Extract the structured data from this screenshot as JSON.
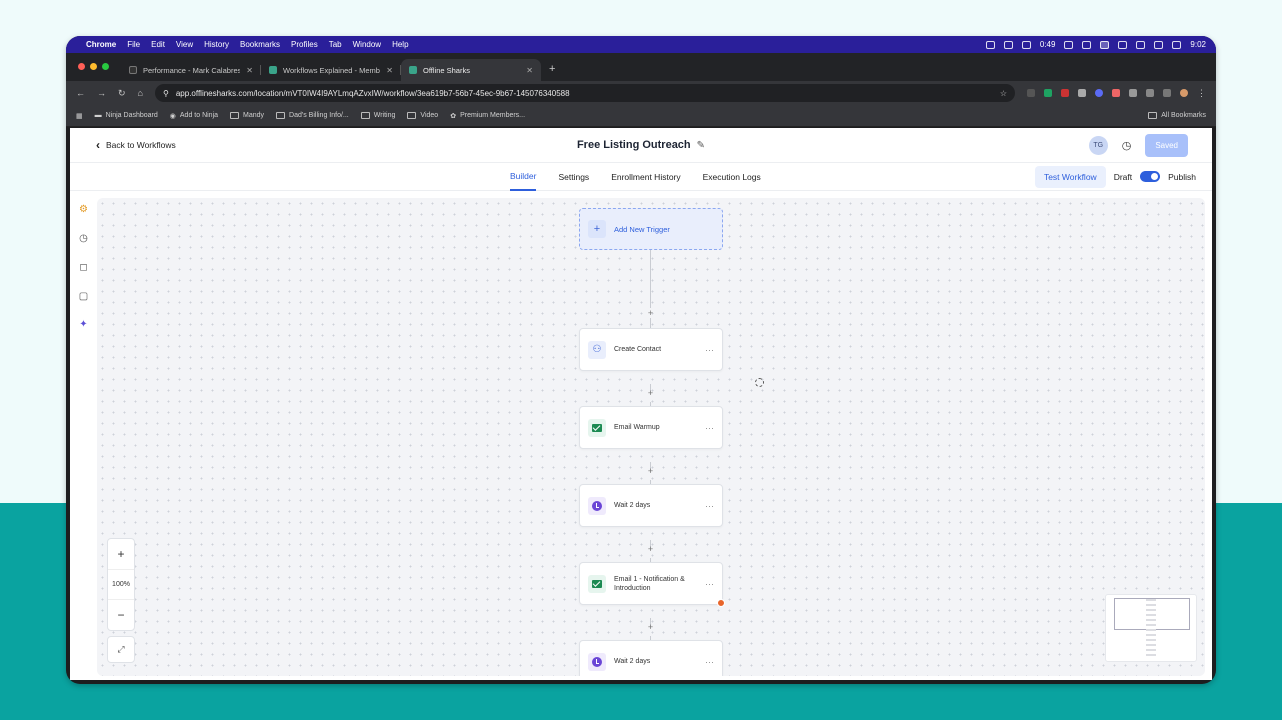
{
  "mac_menu": {
    "app": "Chrome",
    "items": [
      "File",
      "Edit",
      "View",
      "History",
      "Bookmarks",
      "Profiles",
      "Tab",
      "Window",
      "Help"
    ],
    "timer": "0:49",
    "clock": "9:02"
  },
  "browser": {
    "tabs": [
      {
        "title": "Performance - Mark Calabrese",
        "active": false
      },
      {
        "title": "Workflows Explained - Membership",
        "active": false
      },
      {
        "title": "Offline Sharks",
        "active": true
      }
    ],
    "url": "app.offlinesharks.com/location/mVT0IW4I9AYLmqAZvxIW/workflow/3ea619b7-56b7-45ec-9b67-145076340588",
    "bookmarks": [
      "Ninja Dashboard",
      "Add to Ninja",
      "Mandy",
      "Dad's Billing Info/...",
      "Writing",
      "Video",
      "Premium Members..."
    ],
    "all_bookmarks": "All Bookmarks"
  },
  "header": {
    "back_label": "Back to Workflows",
    "title": "Free Listing Outreach",
    "avatar_initials": "TG",
    "saved_label": "Saved"
  },
  "subnav": {
    "tabs": [
      {
        "label": "Builder",
        "active": true
      },
      {
        "label": "Settings",
        "active": false
      },
      {
        "label": "Enrollment History",
        "active": false
      },
      {
        "label": "Execution Logs",
        "active": false
      }
    ],
    "test_label": "Test Workflow",
    "draft_label": "Draft",
    "publish_label": "Publish"
  },
  "workflow": {
    "trigger_label": "Add New Trigger",
    "steps": [
      {
        "label": "Create Contact",
        "icon": "person-icon"
      },
      {
        "label": "Email Warmup",
        "icon": "email-icon"
      },
      {
        "label": "Wait 2 days",
        "icon": "clock-icon"
      },
      {
        "label": "Email 1 - Notification & Introduction",
        "icon": "email-icon",
        "error": true
      },
      {
        "label": "Wait 2 days",
        "icon": "clock-icon"
      }
    ]
  },
  "zoom": {
    "in": "+",
    "level": "100%",
    "out": "−"
  },
  "colors": {
    "accent": "#2e5fdc",
    "email_green": "#1c8a52",
    "wait_purple": "#6b46d6",
    "error": "#e8652b"
  }
}
